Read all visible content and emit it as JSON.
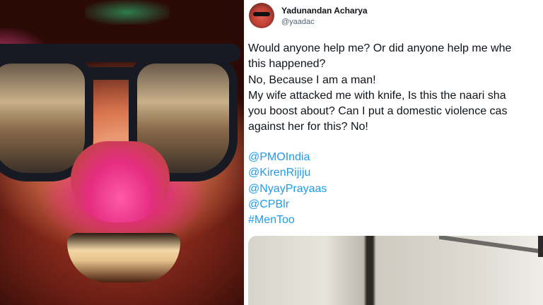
{
  "tweet": {
    "display_name": "Yadunandan Acharya",
    "handle": "@yaadac",
    "body_lines": [
      "Would anyone help me? Or did anyone help me whe",
      "this happened?",
      "No, Because I am a man!",
      "My wife attacked me with knife, Is this the naari sha",
      "you boost about? Can I put a domestic violence cas",
      "against her for this? No!"
    ],
    "mentions": [
      "@PMOIndia",
      "@KirenRijiju",
      "@NyayPrayaas",
      "@CPBlr",
      "#MenToo"
    ]
  },
  "colors": {
    "link": "#1d9bf0",
    "text": "#0f1419",
    "secondary_text": "#536471"
  }
}
